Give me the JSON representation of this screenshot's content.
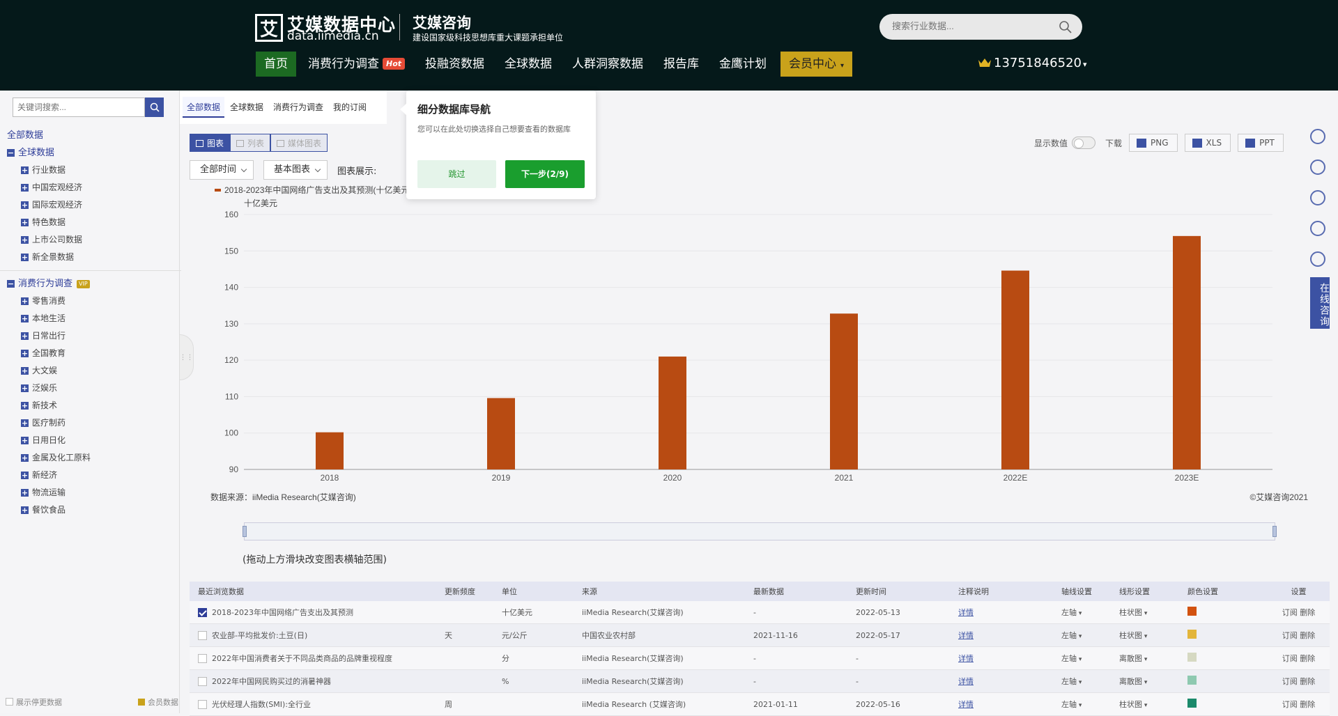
{
  "header": {
    "logo_mark": "艾",
    "logo_cn": "艾媒数据中心",
    "logo_en": "data.iimedia.cn",
    "brand": "艾媒咨询",
    "brand_sub": "建设国家级科技思想库重大课题承担单位",
    "search_placeholder": "搜索行业数据...",
    "nav": [
      {
        "label": "首页",
        "active": true
      },
      {
        "label": "消费行为调查",
        "badge": "Hot"
      },
      {
        "label": "投融资数据"
      },
      {
        "label": "全球数据"
      },
      {
        "label": "人群洞察数据"
      },
      {
        "label": "报告库"
      },
      {
        "label": "金鹰计划"
      },
      {
        "label": "会员中心"
      }
    ],
    "user_phone": "13751846520"
  },
  "sidebar": {
    "search_placeholder": "关键词搜索...",
    "root": "全部数据",
    "groups": [
      {
        "label": "全球数据",
        "items": [
          "行业数据",
          "中国宏观经济",
          "国际宏观经济",
          "特色数据",
          "上市公司数据",
          "新全景数据"
        ]
      },
      {
        "label": "消费行为调查",
        "badge": "VIP",
        "items": [
          "零售消费",
          "本地生活",
          "日常出行",
          "全国教育",
          "大文娱",
          "泛娱乐",
          "新技术",
          "医疗制药",
          "日用日化",
          "金属及化工原料",
          "新经济",
          "物流运输",
          "餐饮食品"
        ]
      }
    ],
    "footer_left": "展示停更数据",
    "footer_right": "会员数据"
  },
  "db_tabs": [
    "全部数据",
    "全球数据",
    "消费行为调查",
    "我的订阅"
  ],
  "view_buttons": [
    "图表",
    "列表",
    "媒体图表"
  ],
  "filters": {
    "time": "全部时间",
    "chart_type": "基本图表",
    "display_label": "图表展示:"
  },
  "tools": {
    "show_values": "显示数值",
    "download": "下载",
    "formats": [
      "PNG",
      "XLS",
      "PPT"
    ]
  },
  "side_consult": "在线咨询",
  "guide": {
    "title": "细分数据库导航",
    "desc": "您可以在此处切换选择自己想要查看的数据库",
    "skip": "跳过",
    "next": "下一步(2/9)"
  },
  "chart_data": {
    "type": "bar",
    "legend": "2018-2023年中国网络广告支出及其预测(十亿美元)",
    "unit_label": "十亿美元",
    "categories": [
      "2018",
      "2019",
      "2020",
      "2021",
      "2022E",
      "2023E"
    ],
    "values": [
      100.2,
      109.6,
      121.0,
      132.8,
      144.6,
      154.1
    ],
    "ylim": [
      90,
      160
    ],
    "yticks": [
      90,
      100,
      110,
      120,
      130,
      140,
      150,
      160
    ],
    "color": "#b84b12",
    "source": "数据来源：iiMedia Research(艾媒咨询)",
    "copyright": "©艾媒咨询2021",
    "grid": true
  },
  "slider_hint": "(拖动上方滑块改变图表横轴范围)",
  "table": {
    "headers": [
      "最近浏览数据",
      "更新频度",
      "单位",
      "来源",
      "最新数据",
      "更新时间",
      "注释说明",
      "轴线设置",
      "线形设置",
      "颜色设置",
      "设置"
    ],
    "rows": [
      {
        "checked": true,
        "name": "2018-2023年中国网络广告支出及其预测",
        "freq": "",
        "unit": "十亿美元",
        "source": "iiMedia Research(艾媒咨询)",
        "latest": "-",
        "updated": "2022-05-13",
        "note": "详情",
        "axis": "左轴",
        "line": "柱状图",
        "color": "#d2520f",
        "ops": "订阅 删除"
      },
      {
        "checked": false,
        "name": "农业部-平均批发价:土豆(日)",
        "freq": "天",
        "unit": "元/公斤",
        "source": "中国农业农村部",
        "latest": "2021-11-16",
        "updated": "2022-05-17",
        "note": "详情",
        "axis": "左轴",
        "line": "柱状图",
        "color": "#e3b53a",
        "ops": "订阅 删除"
      },
      {
        "checked": false,
        "name": "2022年中国消费者关于不同品类商品的品牌重视程度",
        "freq": "",
        "unit": "分",
        "source": "iiMedia Research(艾媒咨询)",
        "latest": "-",
        "updated": "-",
        "note": "详情",
        "axis": "左轴",
        "line": "离散图",
        "color": "#d6d9c2",
        "ops": "订阅 删除"
      },
      {
        "checked": false,
        "name": "2022年中国网民购买过的消暑神器",
        "freq": "",
        "unit": "%",
        "source": "iiMedia Research(艾媒咨询)",
        "latest": "-",
        "updated": "-",
        "note": "详情",
        "axis": "左轴",
        "line": "离散图",
        "color": "#8ec9b0",
        "ops": "订阅 删除"
      },
      {
        "checked": false,
        "name": "光伏经理人指数(SMI):全行业",
        "freq": "周",
        "unit": "",
        "source": "iiMedia Research (艾媒咨询)",
        "latest": "2021-01-11",
        "updated": "2022-05-16",
        "note": "详情",
        "axis": "左轴",
        "line": "柱状图",
        "color": "#1b8a6b",
        "ops": "订阅 删除"
      }
    ]
  }
}
